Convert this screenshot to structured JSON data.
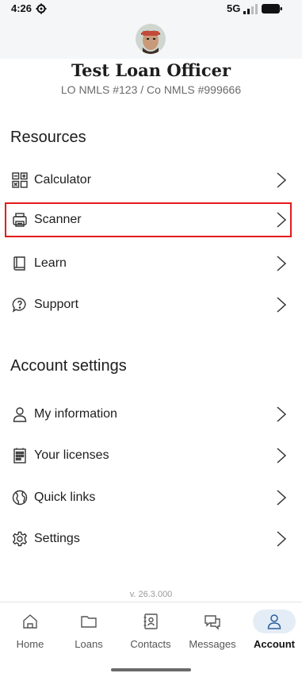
{
  "status_bar": {
    "time": "4:26",
    "network": "5G"
  },
  "profile": {
    "name": "Test Loan Officer",
    "nmls": "LO NMLS #123 / Co NMLS #999666"
  },
  "resources": {
    "title": "Resources",
    "items": [
      {
        "label": "Calculator",
        "icon": "calculator-icon"
      },
      {
        "label": "Scanner",
        "icon": "scanner-icon"
      },
      {
        "label": "Learn",
        "icon": "book-icon"
      },
      {
        "label": "Support",
        "icon": "help-chat-icon"
      }
    ]
  },
  "account_settings": {
    "title": "Account settings",
    "items": [
      {
        "label": "My information",
        "icon": "user-icon"
      },
      {
        "label": "Your licenses",
        "icon": "license-icon"
      },
      {
        "label": "Quick links",
        "icon": "globe-icon"
      },
      {
        "label": "Settings",
        "icon": "gear-icon"
      }
    ]
  },
  "version": "v. 26.3.000",
  "tabs": [
    {
      "label": "Home",
      "icon": "home-icon"
    },
    {
      "label": "Loans",
      "icon": "folder-icon"
    },
    {
      "label": "Contacts",
      "icon": "contacts-icon"
    },
    {
      "label": "Messages",
      "icon": "messages-icon"
    },
    {
      "label": "Account",
      "icon": "account-icon",
      "active": true
    }
  ],
  "colors": {
    "highlight": "#e41b1b",
    "active_tab_pill": "#e4edf6"
  }
}
